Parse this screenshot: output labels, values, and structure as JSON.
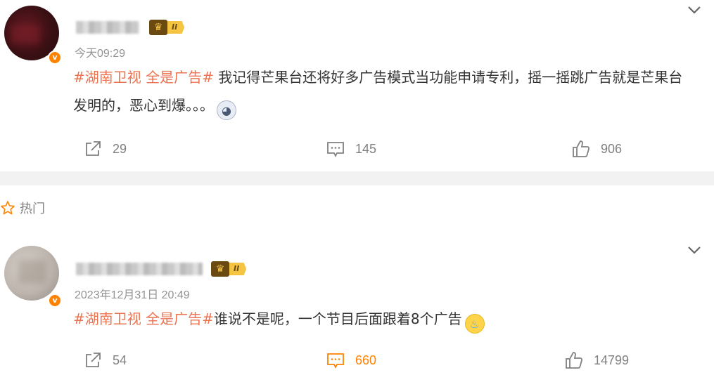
{
  "posts": [
    {
      "vip_level": "II",
      "verified_mark": "v",
      "time": "今天09:29",
      "content": {
        "topic": "#湖南卫视 全是广告#",
        "text": " 我记得芒果台还将好多广告模式当功能申请专利，摇一摇跳广告就是芒果台发明的，恶心到爆。。。",
        "emoji": "shocked-face-emoji"
      },
      "actions": {
        "forward": "29",
        "comment": "145",
        "like": "906"
      },
      "comment_active": false
    },
    {
      "vip_level": "II",
      "verified_mark": "v",
      "time": "2023年12月31日 20:49",
      "content": {
        "topic": "#湖南卫视 全是广告#",
        "text": "谁说不是呢，一个节目后面跟着8个广告",
        "emoji": "crying-face-emoji"
      },
      "actions": {
        "forward": "54",
        "comment": "660",
        "like": "14799"
      },
      "comment_active": true
    }
  ],
  "section": {
    "hot_label": "热门",
    "icon": "star-icon"
  },
  "colors": {
    "topic": "#eb7350",
    "accent": "#ff8200",
    "muted": "#808080",
    "divider": "#f2f2f2"
  }
}
